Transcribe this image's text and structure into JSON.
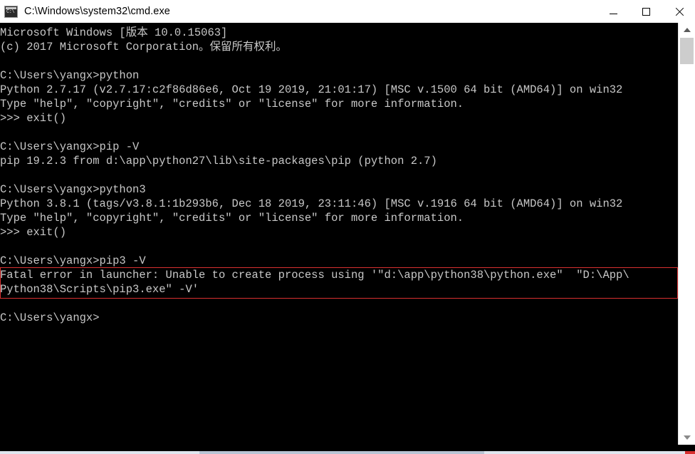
{
  "window": {
    "title": "C:\\Windows\\system32\\cmd.exe",
    "icon": "cmd-console-icon",
    "controls": {
      "minimize_label": "Minimize",
      "maximize_label": "Maximize",
      "close_label": "Close"
    }
  },
  "console": {
    "background_color": "#000000",
    "text_color": "#c8c8c8",
    "lines": [
      "Microsoft Windows [版本 10.0.15063]",
      "(c) 2017 Microsoft Corporation。保留所有权利。",
      "",
      "C:\\Users\\yangx>python",
      "Python 2.7.17 (v2.7.17:c2f86d86e6, Oct 19 2019, 21:01:17) [MSC v.1500 64 bit (AMD64)] on win32",
      "Type \"help\", \"copyright\", \"credits\" or \"license\" for more information.",
      ">>> exit()",
      "",
      "C:\\Users\\yangx>pip -V",
      "pip 19.2.3 from d:\\app\\python27\\lib\\site-packages\\pip (python 2.7)",
      "",
      "C:\\Users\\yangx>python3",
      "Python 3.8.1 (tags/v3.8.1:1b293b6, Dec 18 2019, 23:11:46) [MSC v.1916 64 bit (AMD64)] on win32",
      "Type \"help\", \"copyright\", \"credits\" or \"license\" for more information.",
      ">>> exit()",
      "",
      "C:\\Users\\yangx>pip3 -V",
      "Fatal error in launcher: Unable to create process using '\"d:\\app\\python38\\python.exe\"  \"D:\\App\\",
      "Python38\\Scripts\\pip3.exe\" -V'",
      "",
      "C:\\Users\\yangx>"
    ]
  },
  "annotation": {
    "kind": "red-highlight-box",
    "color": "#d83030",
    "covers_text": "Fatal error in launcher: Unable to create process using '\"d:\\app\\python38\\python.exe\"  \"D:\\App\\Python38\\Scripts\\pip3.exe\" -V'"
  },
  "scrollbars": {
    "vertical": {
      "up_icon": "chevron-up-icon",
      "down_icon": "chevron-down-icon",
      "thumb_color": "#cdcdcd"
    },
    "horizontal": {
      "thumb_color": "#b8c4d4"
    }
  }
}
